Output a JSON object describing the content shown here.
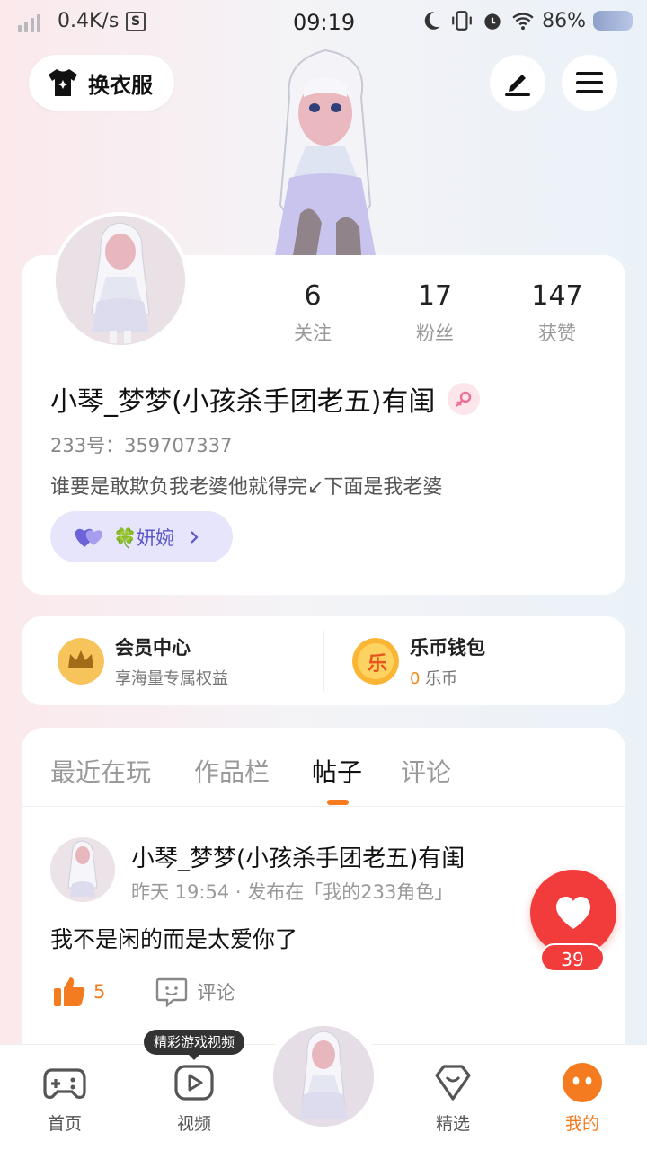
{
  "status_bar": {
    "net_speed": "0.4K/s",
    "s_badge": "S",
    "time": "09:19",
    "battery": "86%"
  },
  "header": {
    "outfit_label": "换衣服"
  },
  "profile": {
    "stats": [
      {
        "value": "6",
        "label": "关注"
      },
      {
        "value": "17",
        "label": "粉丝"
      },
      {
        "value": "147",
        "label": "获赞"
      }
    ],
    "nickname": "小琴_梦梦(小孩杀手团老五)有闺",
    "uid": "233号：359707337",
    "bio": "谁要是敢欺负我老婆他就得完↙下面是我老婆",
    "relation_label": "🍀妍婉"
  },
  "vip": {
    "member_title": "会员中心",
    "member_sub": "享海量专属权益",
    "wallet_title": "乐币钱包",
    "wallet_amount": "0",
    "wallet_unit": "乐币",
    "coin_char": "乐"
  },
  "tabs": [
    "最近在玩",
    "作品栏",
    "帖子",
    "评论"
  ],
  "active_tab": "帖子",
  "post": {
    "author": "小琴_梦梦(小孩杀手团老五)有闺",
    "meta": "昨天 19:54 · 发布在「我的233角色」",
    "text": "我不是闲的而是太爱你了",
    "likes": "5",
    "comment_label": "评论"
  },
  "heart_fab": {
    "count": "39"
  },
  "bottom_nav": {
    "items": [
      "首页",
      "视频",
      "精选",
      "我的"
    ],
    "video_tip": "精彩游戏视频"
  },
  "colors": {
    "accent": "#f47b20",
    "heart": "#f23c3c",
    "relation": "#5d56c9"
  }
}
